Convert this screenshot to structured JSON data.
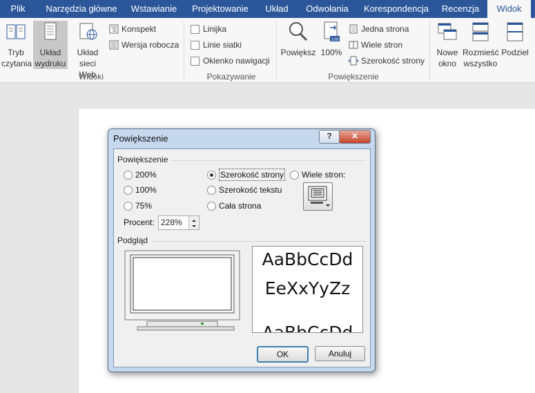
{
  "ribbon_tabs": [
    "Plik",
    "Narzędzia główne",
    "Wstawianie",
    "Projektowanie",
    "Układ",
    "Odwołania",
    "Korespondencja",
    "Recenzja",
    "Widok"
  ],
  "active_tab": "Widok",
  "groups": {
    "widoki": {
      "label": "Widoki",
      "tryb_czytania": [
        "Tryb",
        "czytania"
      ],
      "uklad_wydruku": [
        "Układ",
        "wydruku"
      ],
      "uklad_sieci_web": [
        "Układ",
        "sieci Web"
      ],
      "konspekt": "Konspekt",
      "wersja_robocza": "Wersja robocza"
    },
    "pokazywanie": {
      "label": "Pokazywanie",
      "linijka": "Linijka",
      "linie_siatki": "Linie siatki",
      "okienko_nawigacji": "Okienko nawigacji"
    },
    "powiekszenie": {
      "label": "Powiększenie",
      "powieksz": "Powiększ",
      "procent": "100%",
      "jedna_strona": "Jedna strona",
      "wiele_stron": "Wiele stron",
      "szerokosc_strony": "Szerokość strony"
    },
    "okno": {
      "nowe_okno": [
        "Nowe",
        "okno"
      ],
      "rozmiesc_wszystko": [
        "Rozmieść",
        "wszystko"
      ],
      "podziel": "Podziel"
    }
  },
  "dialog": {
    "title": "Powiększenie",
    "help_glyph": "?",
    "close_glyph": "✕",
    "zoom_section": "Powiększenie",
    "options_left": [
      "200%",
      "100%",
      "75%"
    ],
    "options_mid": [
      "Szerokość strony",
      "Szerokość tekstu",
      "Cała strona"
    ],
    "selected_option": "Szerokość strony",
    "many_pages": "Wiele stron:",
    "percent_label": "Procent:",
    "percent_value": "228%",
    "preview_section": "Podgląd",
    "preview_text": [
      "AaBbCcDd",
      "EeXxYyZz",
      "AaBbCcDd"
    ],
    "ok": "OK",
    "cancel": "Anuluj"
  },
  "colors": {
    "ribbon_blue": "#2b579a",
    "selected_button": "#c8c8c8",
    "dialog_frame": "#c5d8ee"
  }
}
